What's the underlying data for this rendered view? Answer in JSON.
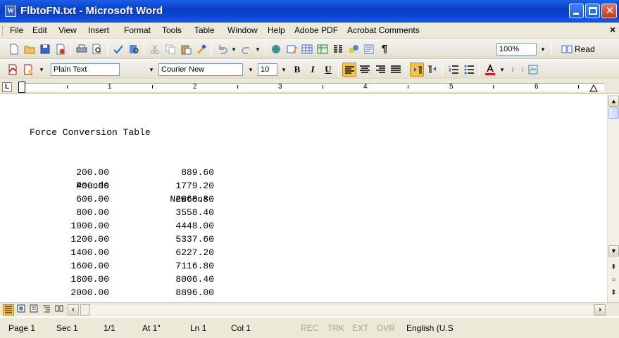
{
  "window": {
    "app_icon": "word-document-icon",
    "title": "FlbtoFN.txt - Microsoft Word",
    "app_icon_glyph": "W"
  },
  "menu": {
    "items": [
      "File",
      "Edit",
      "View",
      "Insert",
      "Format",
      "Tools",
      "Table",
      "Window",
      "Help",
      "Adobe PDF",
      "Acrobat Comments"
    ],
    "close_doc": "×"
  },
  "toolbar": {
    "zoom": "100%",
    "read_label": "Read",
    "style": "Plain Text",
    "font": "Courier New",
    "size": "10",
    "bold": "B",
    "italic": "I",
    "underline": "U",
    "pilcrow": "¶"
  },
  "ruler": {
    "numbers": [
      "1",
      "2",
      "3",
      "4",
      "5",
      "6"
    ],
    "tab_selector": "L"
  },
  "document": {
    "title": "Force Conversion Table",
    "headers": [
      "Pounds",
      "Newtons"
    ],
    "rows": [
      [
        "200.00",
        "889.60"
      ],
      [
        "400.00",
        "1779.20"
      ],
      [
        "600.00",
        "2668.80"
      ],
      [
        "800.00",
        "3558.40"
      ],
      [
        "1000.00",
        "4448.00"
      ],
      [
        "1200.00",
        "5337.60"
      ],
      [
        "1400.00",
        "6227.20"
      ],
      [
        "1600.00",
        "7116.80"
      ],
      [
        "1800.00",
        "8006.40"
      ],
      [
        "2000.00",
        "8896.00"
      ]
    ]
  },
  "status": {
    "page": "Page 1",
    "sec": "Sec 1",
    "pages": "1/1",
    "at": "At 1\"",
    "ln": "Ln 1",
    "col": "Col 1",
    "rec": "REC",
    "trk": "TRK",
    "ext": "EXT",
    "ovr": "OVR",
    "lang": "English (U.S"
  },
  "colors": {
    "titlebar": "#0a3fc3",
    "chrome": "#ece9d8",
    "active_button": "#f7c24c"
  }
}
